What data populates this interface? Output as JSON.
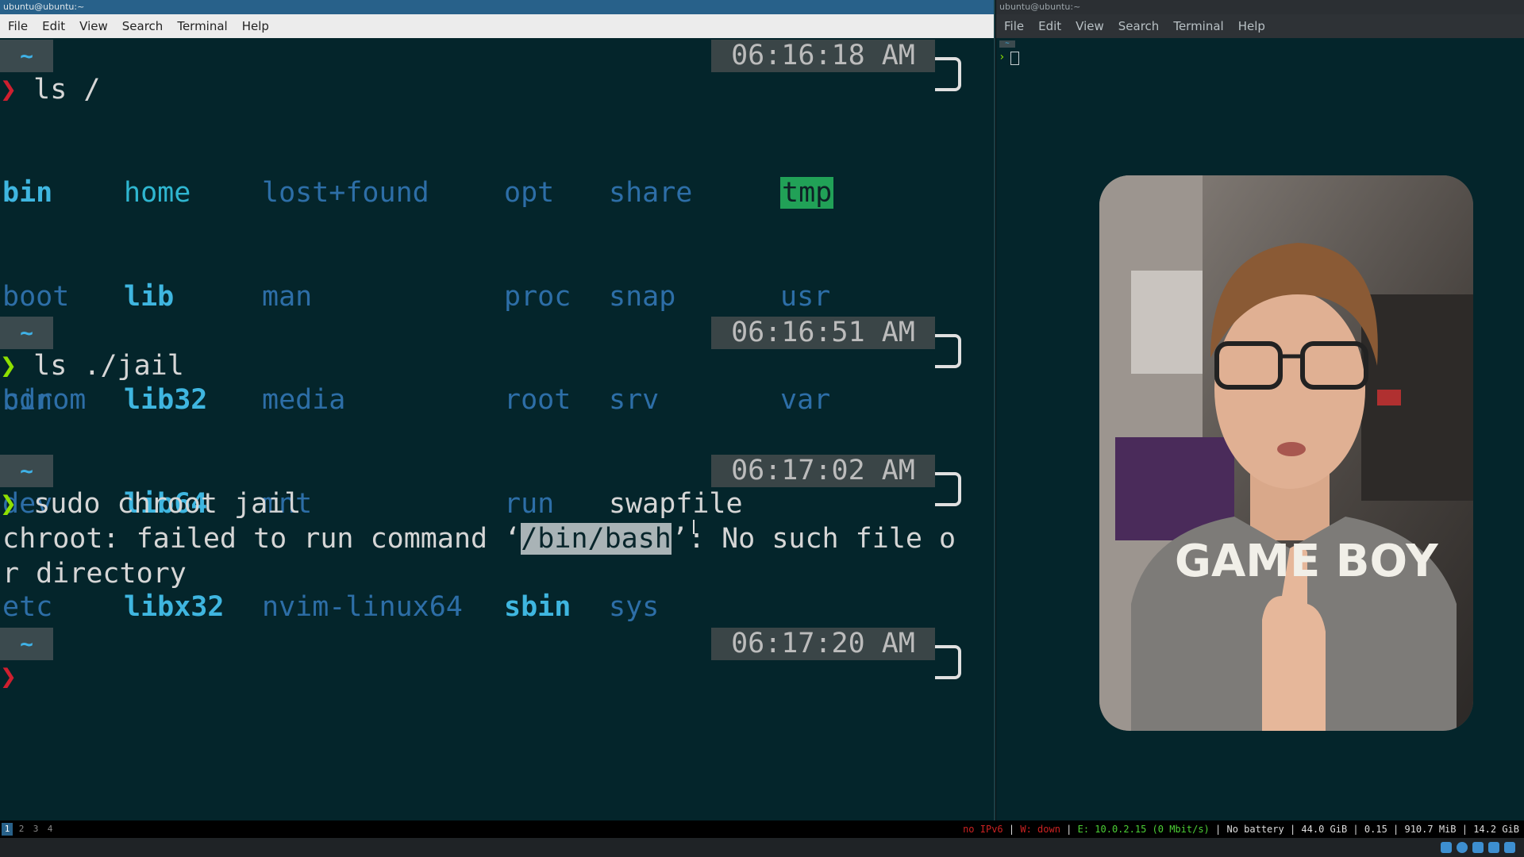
{
  "left_window": {
    "title": "ubuntu@ubuntu:~",
    "menu": [
      "File",
      "Edit",
      "View",
      "Search",
      "Terminal",
      "Help"
    ]
  },
  "right_window": {
    "title": "ubuntu@ubuntu:~",
    "menu": [
      "File",
      "Edit",
      "View",
      "Search",
      "Terminal",
      "Help"
    ],
    "prompt_tilde": "~",
    "prompt_chevron": "›"
  },
  "terminal": {
    "prompt_tilde": "~",
    "chevron": "❯",
    "blocks": [
      {
        "time": "06:16:18 AM",
        "command": "ls /"
      },
      {
        "time": "06:16:51 AM",
        "command": "ls ./jail",
        "output": "bin"
      },
      {
        "time": "06:17:02 AM",
        "command": "sudo chroot jail",
        "error_part1": "chroot: failed to run command ‘",
        "error_highlight": "/bin/bash",
        "error_part2": "’: No such file o",
        "error_line2": "r directory"
      },
      {
        "time": "06:17:20 AM"
      }
    ],
    "ls_root": [
      [
        "bin",
        "boot",
        "cdrom",
        "dev",
        "etc"
      ],
      [
        "home",
        "lib",
        "lib32",
        "lib64",
        "libx32"
      ],
      [
        "lost+found",
        "man",
        "media",
        "mnt",
        "nvim-linux64"
      ],
      [
        "opt",
        "proc",
        "root",
        "run",
        "sbin"
      ],
      [
        "share",
        "snap",
        "srv",
        "swapfile",
        "sys"
      ],
      [
        "tmp",
        "usr",
        "var"
      ]
    ]
  },
  "statusbar": {
    "workspaces": [
      "1",
      "2",
      "3",
      "4"
    ],
    "red1": "no IPv6",
    "red2": "W: down",
    "eth": "E: 10.0.2.15 (0 Mbit/s)",
    "battery": "No battery",
    "disk": "44.0 GiB",
    "load": "0.15",
    "mem": "910.7 MiB",
    "free": "14.2 GiB"
  },
  "webcam": {
    "shirt_text": "GAME BOY"
  }
}
